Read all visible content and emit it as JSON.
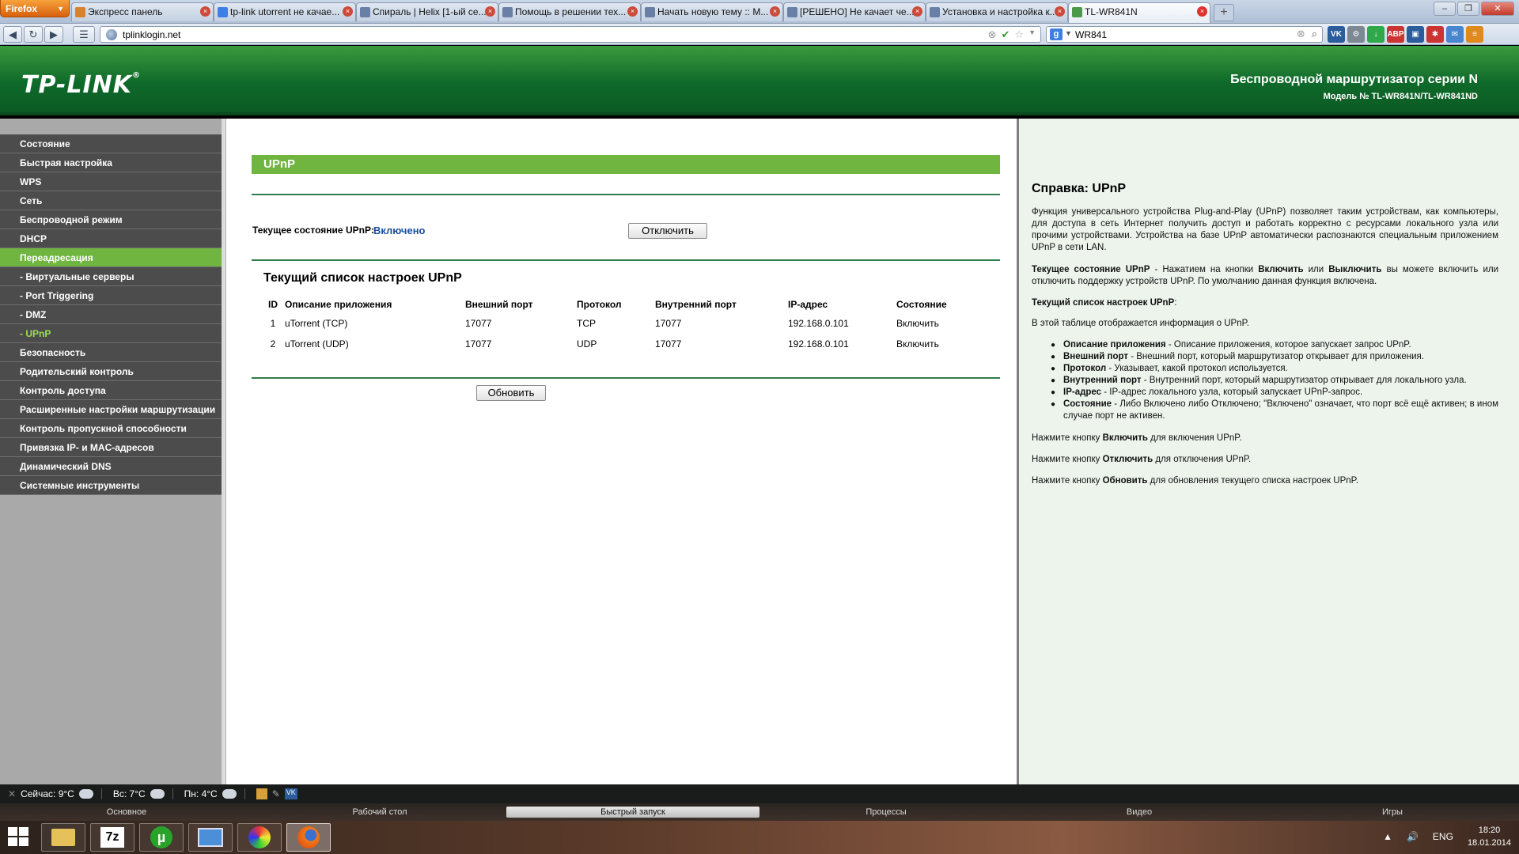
{
  "browser": {
    "app_button": "Firefox",
    "tabs": [
      {
        "label": "Экспресс панель",
        "fav_color": "#d9822b"
      },
      {
        "label": "tp-link utorrent не качае...",
        "fav_color": "#3d7fe6"
      },
      {
        "label": "Спираль | Helix [1-ый се...",
        "fav_color": "#6a7fa6"
      },
      {
        "label": "Помощь в решении тех...",
        "fav_color": "#6a7fa6"
      },
      {
        "label": "Начать новую тему :: М...",
        "fav_color": "#6a7fa6"
      },
      {
        "label": "[РЕШЕНО] Не качает че...",
        "fav_color": "#6a7fa6"
      },
      {
        "label": "Установка и настройка к...",
        "fav_color": "#6a7fa6"
      },
      {
        "label": "TL-WR841N",
        "fav_color": "#4a9a4a"
      }
    ],
    "url": "tplinklogin.net",
    "search_value": "WR841",
    "search_engine_label": "g"
  },
  "header": {
    "logo": "TP-LINK",
    "logo_mark": "®",
    "title": "Беспроводной маршрутизатор серии N",
    "model": "Модель № TL-WR841N/TL-WR841ND"
  },
  "menu": [
    {
      "label": "Состояние",
      "state": ""
    },
    {
      "label": "Быстрая настройка",
      "state": ""
    },
    {
      "label": "WPS",
      "state": ""
    },
    {
      "label": "Сеть",
      "state": ""
    },
    {
      "label": "Беспроводной режим",
      "state": ""
    },
    {
      "label": "DHCP",
      "state": ""
    },
    {
      "label": "Переадресация",
      "state": "active-parent"
    },
    {
      "label": "- Виртуальные серверы",
      "state": "sub"
    },
    {
      "label": "- Port Triggering",
      "state": "sub"
    },
    {
      "label": "- DMZ",
      "state": "sub"
    },
    {
      "label": "- UPnP",
      "state": "sub active"
    },
    {
      "label": "Безопасность",
      "state": ""
    },
    {
      "label": "Родительский контроль",
      "state": ""
    },
    {
      "label": "Контроль доступа",
      "state": ""
    },
    {
      "label": "Расширенные настройки маршрутизации",
      "state": ""
    },
    {
      "label": "Контроль пропускной способности",
      "state": ""
    },
    {
      "label": "Привязка IP- и MAC-адресов",
      "state": ""
    },
    {
      "label": "Динамический DNS",
      "state": ""
    },
    {
      "label": "Системные инструменты",
      "state": ""
    }
  ],
  "main": {
    "section_title": "UPnP",
    "status_label": "Текущее состояние UPnP:",
    "status_value": "Включено",
    "disable_button": "Отключить",
    "list_title": "Текущий список настроек UPnP",
    "columns": [
      "ID",
      "Описание приложения",
      "Внешний порт",
      "Протокол",
      "Внутренний порт",
      "IP-адрес",
      "Состояние"
    ],
    "rows": [
      [
        "1",
        "uTorrent (TCP)",
        "17077",
        "TCP",
        "17077",
        "192.168.0.101",
        "Включить"
      ],
      [
        "2",
        "uTorrent (UDP)",
        "17077",
        "UDP",
        "17077",
        "192.168.0.101",
        "Включить"
      ]
    ],
    "refresh_button": "Обновить"
  },
  "help": {
    "title": "Справка: UPnP",
    "intro": "Функция универсального устройства Plug-and-Play (UPnP) позволяет таким устройствам, как компьютеры, для доступа в сеть Интернет получить доступ и работать корректно с ресурсами локального узла или прочими устройствами. Устройства на базе UPnP автоматически распознаются специальным приложением UPnP в сети LAN.",
    "status_term": "Текущее состояние UPnP",
    "status_text_1": " - Нажатием на кнопки ",
    "status_on": "Включить",
    "status_text_2": " или ",
    "status_off": "Выключить",
    "status_text_3": " вы можете включить или отключить поддержку устройств UPnP. По умолчанию данная функция включена.",
    "list_term": "Текущий список настроек UPnP",
    "list_colon": ":",
    "table_text": "В этой таблице отображается информация о UPnP.",
    "items": [
      {
        "term": "Описание приложения",
        "text": " - Описание приложения, которое запускает запрос UPnP."
      },
      {
        "term": "Внешний порт",
        "text": " - Внешний порт, который маршрутизатор открывает для приложения."
      },
      {
        "term": "Протокол",
        "text": " - Указывает, какой протокол используется."
      },
      {
        "term": "Внутренний порт",
        "text": " - Внутренний порт, который маршрутизатор открывает для локального узла."
      },
      {
        "term": "IP-адрес",
        "text": " - IP-адрес локального узла, который запускает UPnP-запрос."
      },
      {
        "term": "Состояние",
        "text": " - Либо Включено либо Отключено; \"Включено\" означает, что порт всё ещё активен; в ином случае порт не активен."
      }
    ],
    "press_1_pre": "Нажмите кнопку ",
    "press_1_btn": "Включить",
    "press_1_post": " для включения UPnP.",
    "press_2_pre": "Нажмите кнопку ",
    "press_2_btn": "Отключить",
    "press_2_post": " для отключения UPnP.",
    "press_3_pre": "Нажмите кнопку ",
    "press_3_btn": "Обновить",
    "press_3_post": " для обновления текущего списка настроек UPnP."
  },
  "statusbar": {
    "weather_now": "Сейчас: 9°C",
    "weather_sun": "Вс: 7°C",
    "weather_mon": "Пн: 4°C",
    "vk_label": "VK"
  },
  "taskbar": {
    "groups": [
      "Основное",
      "Рабочий стол",
      "Быстрый запуск",
      "Процессы",
      "Видео",
      "Игры"
    ],
    "active_group": "Быстрый запуск",
    "lang": "ENG",
    "time": "18:20",
    "date": "18.01.2014"
  }
}
